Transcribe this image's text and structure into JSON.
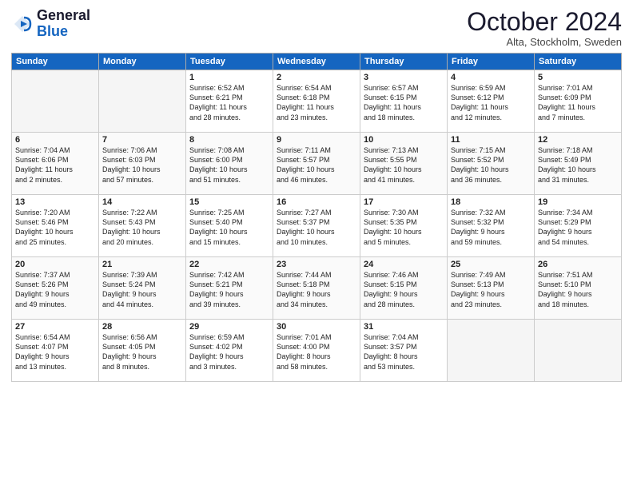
{
  "header": {
    "logo_general": "General",
    "logo_blue": "Blue",
    "month": "October 2024",
    "location": "Alta, Stockholm, Sweden"
  },
  "weekdays": [
    "Sunday",
    "Monday",
    "Tuesday",
    "Wednesday",
    "Thursday",
    "Friday",
    "Saturday"
  ],
  "rows": [
    [
      {
        "day": "",
        "lines": [],
        "empty": true
      },
      {
        "day": "",
        "lines": [],
        "empty": true
      },
      {
        "day": "1",
        "lines": [
          "Sunrise: 6:52 AM",
          "Sunset: 6:21 PM",
          "Daylight: 11 hours",
          "and 28 minutes."
        ]
      },
      {
        "day": "2",
        "lines": [
          "Sunrise: 6:54 AM",
          "Sunset: 6:18 PM",
          "Daylight: 11 hours",
          "and 23 minutes."
        ]
      },
      {
        "day": "3",
        "lines": [
          "Sunrise: 6:57 AM",
          "Sunset: 6:15 PM",
          "Daylight: 11 hours",
          "and 18 minutes."
        ]
      },
      {
        "day": "4",
        "lines": [
          "Sunrise: 6:59 AM",
          "Sunset: 6:12 PM",
          "Daylight: 11 hours",
          "and 12 minutes."
        ]
      },
      {
        "day": "5",
        "lines": [
          "Sunrise: 7:01 AM",
          "Sunset: 6:09 PM",
          "Daylight: 11 hours",
          "and 7 minutes."
        ]
      }
    ],
    [
      {
        "day": "6",
        "lines": [
          "Sunrise: 7:04 AM",
          "Sunset: 6:06 PM",
          "Daylight: 11 hours",
          "and 2 minutes."
        ]
      },
      {
        "day": "7",
        "lines": [
          "Sunrise: 7:06 AM",
          "Sunset: 6:03 PM",
          "Daylight: 10 hours",
          "and 57 minutes."
        ]
      },
      {
        "day": "8",
        "lines": [
          "Sunrise: 7:08 AM",
          "Sunset: 6:00 PM",
          "Daylight: 10 hours",
          "and 51 minutes."
        ]
      },
      {
        "day": "9",
        "lines": [
          "Sunrise: 7:11 AM",
          "Sunset: 5:57 PM",
          "Daylight: 10 hours",
          "and 46 minutes."
        ]
      },
      {
        "day": "10",
        "lines": [
          "Sunrise: 7:13 AM",
          "Sunset: 5:55 PM",
          "Daylight: 10 hours",
          "and 41 minutes."
        ]
      },
      {
        "day": "11",
        "lines": [
          "Sunrise: 7:15 AM",
          "Sunset: 5:52 PM",
          "Daylight: 10 hours",
          "and 36 minutes."
        ]
      },
      {
        "day": "12",
        "lines": [
          "Sunrise: 7:18 AM",
          "Sunset: 5:49 PM",
          "Daylight: 10 hours",
          "and 31 minutes."
        ]
      }
    ],
    [
      {
        "day": "13",
        "lines": [
          "Sunrise: 7:20 AM",
          "Sunset: 5:46 PM",
          "Daylight: 10 hours",
          "and 25 minutes."
        ]
      },
      {
        "day": "14",
        "lines": [
          "Sunrise: 7:22 AM",
          "Sunset: 5:43 PM",
          "Daylight: 10 hours",
          "and 20 minutes."
        ]
      },
      {
        "day": "15",
        "lines": [
          "Sunrise: 7:25 AM",
          "Sunset: 5:40 PM",
          "Daylight: 10 hours",
          "and 15 minutes."
        ]
      },
      {
        "day": "16",
        "lines": [
          "Sunrise: 7:27 AM",
          "Sunset: 5:37 PM",
          "Daylight: 10 hours",
          "and 10 minutes."
        ]
      },
      {
        "day": "17",
        "lines": [
          "Sunrise: 7:30 AM",
          "Sunset: 5:35 PM",
          "Daylight: 10 hours",
          "and 5 minutes."
        ]
      },
      {
        "day": "18",
        "lines": [
          "Sunrise: 7:32 AM",
          "Sunset: 5:32 PM",
          "Daylight: 9 hours",
          "and 59 minutes."
        ]
      },
      {
        "day": "19",
        "lines": [
          "Sunrise: 7:34 AM",
          "Sunset: 5:29 PM",
          "Daylight: 9 hours",
          "and 54 minutes."
        ]
      }
    ],
    [
      {
        "day": "20",
        "lines": [
          "Sunrise: 7:37 AM",
          "Sunset: 5:26 PM",
          "Daylight: 9 hours",
          "and 49 minutes."
        ]
      },
      {
        "day": "21",
        "lines": [
          "Sunrise: 7:39 AM",
          "Sunset: 5:24 PM",
          "Daylight: 9 hours",
          "and 44 minutes."
        ]
      },
      {
        "day": "22",
        "lines": [
          "Sunrise: 7:42 AM",
          "Sunset: 5:21 PM",
          "Daylight: 9 hours",
          "and 39 minutes."
        ]
      },
      {
        "day": "23",
        "lines": [
          "Sunrise: 7:44 AM",
          "Sunset: 5:18 PM",
          "Daylight: 9 hours",
          "and 34 minutes."
        ]
      },
      {
        "day": "24",
        "lines": [
          "Sunrise: 7:46 AM",
          "Sunset: 5:15 PM",
          "Daylight: 9 hours",
          "and 28 minutes."
        ]
      },
      {
        "day": "25",
        "lines": [
          "Sunrise: 7:49 AM",
          "Sunset: 5:13 PM",
          "Daylight: 9 hours",
          "and 23 minutes."
        ]
      },
      {
        "day": "26",
        "lines": [
          "Sunrise: 7:51 AM",
          "Sunset: 5:10 PM",
          "Daylight: 9 hours",
          "and 18 minutes."
        ]
      }
    ],
    [
      {
        "day": "27",
        "lines": [
          "Sunrise: 6:54 AM",
          "Sunset: 4:07 PM",
          "Daylight: 9 hours",
          "and 13 minutes."
        ]
      },
      {
        "day": "28",
        "lines": [
          "Sunrise: 6:56 AM",
          "Sunset: 4:05 PM",
          "Daylight: 9 hours",
          "and 8 minutes."
        ]
      },
      {
        "day": "29",
        "lines": [
          "Sunrise: 6:59 AM",
          "Sunset: 4:02 PM",
          "Daylight: 9 hours",
          "and 3 minutes."
        ]
      },
      {
        "day": "30",
        "lines": [
          "Sunrise: 7:01 AM",
          "Sunset: 4:00 PM",
          "Daylight: 8 hours",
          "and 58 minutes."
        ]
      },
      {
        "day": "31",
        "lines": [
          "Sunrise: 7:04 AM",
          "Sunset: 3:57 PM",
          "Daylight: 8 hours",
          "and 53 minutes."
        ]
      },
      {
        "day": "",
        "lines": [],
        "empty": true
      },
      {
        "day": "",
        "lines": [],
        "empty": true
      }
    ]
  ]
}
